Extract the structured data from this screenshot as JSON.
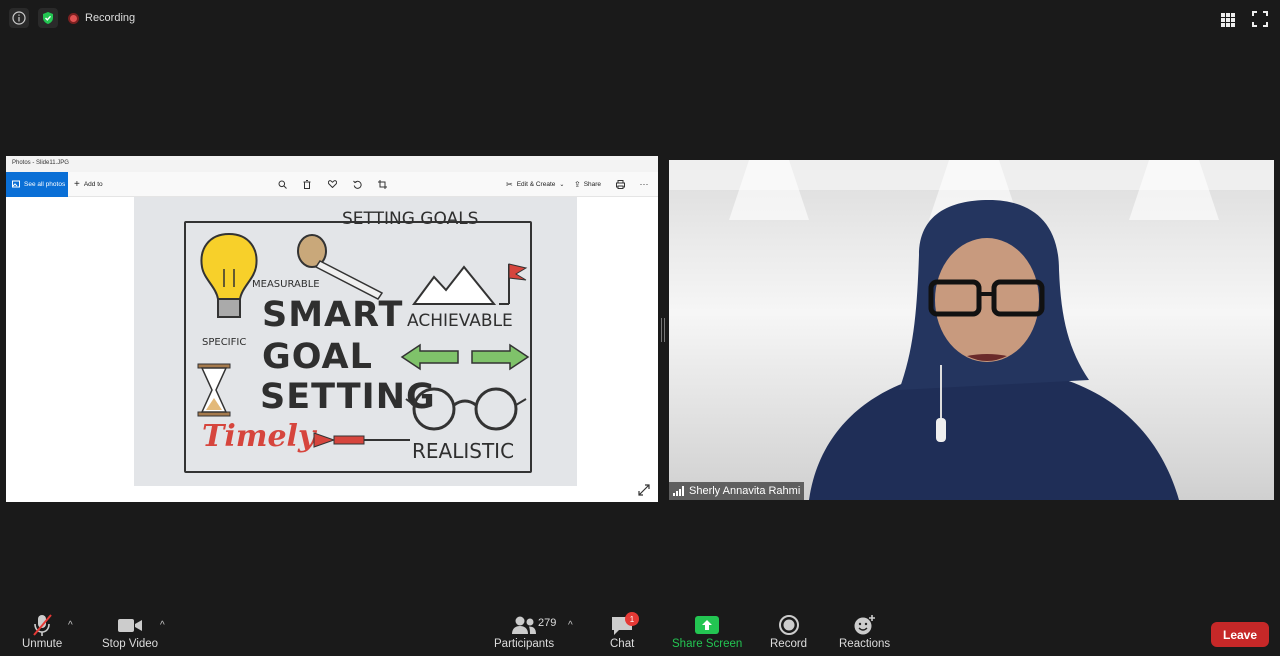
{
  "top": {
    "recording_label": "Recording"
  },
  "shared_screen": {
    "window_title": "Photos - Slide11.JPG",
    "see_all_photos": "See all photos",
    "add_to": "Add to",
    "edit_create": "Edit & Create",
    "share": "Share",
    "more": "···",
    "slide_texts": {
      "setting_goals": "SETTING GOALS",
      "measurable": "MEASURABLE",
      "smart": "SMART",
      "goal": "GOAL",
      "setting": "SETTING",
      "achievable": "ACHIEVABLE",
      "specific": "SPECIFIC",
      "timely": "Timely",
      "realistic": "REALISTIC"
    }
  },
  "video": {
    "participant_name": "Sherly Annavita Rahmi"
  },
  "toolbar": {
    "unmute": "Unmute",
    "stop_video": "Stop Video",
    "participants": "Participants",
    "participants_count": "279",
    "chat": "Chat",
    "chat_badge": "1",
    "share_screen": "Share Screen",
    "record": "Record",
    "reactions": "Reactions",
    "leave": "Leave"
  },
  "colors": {
    "accent_blue": "#0a6fd6",
    "share_green": "#23c552",
    "leave_red": "#c62828",
    "badge_red": "#e53935"
  }
}
